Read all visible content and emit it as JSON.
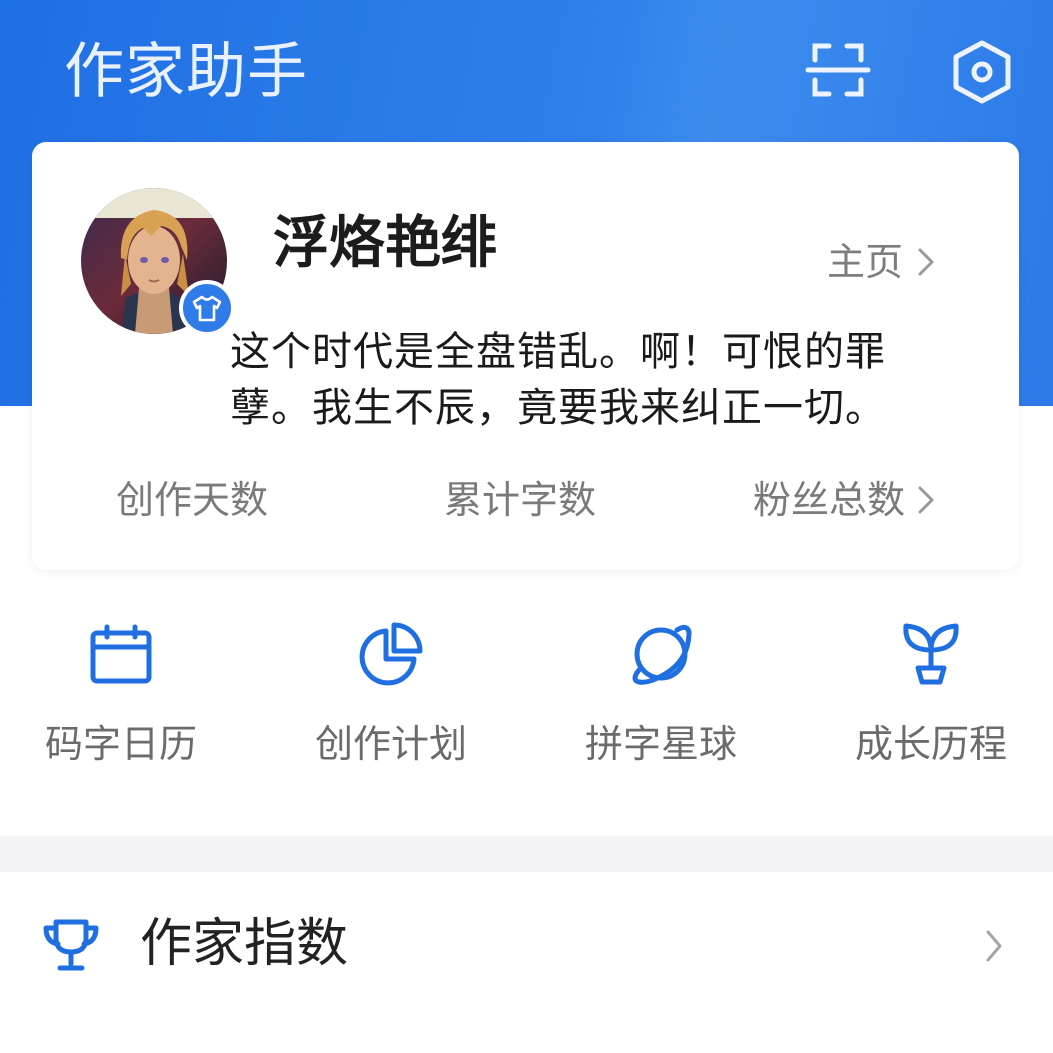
{
  "header": {
    "title": "作家助手",
    "scan_icon": "scan-icon",
    "settings_icon": "settings-hexagon-icon"
  },
  "profile": {
    "username": "浮烙艳绯",
    "homepage_label": "主页",
    "bio_line1": "这个时代是全盘错乱。啊！可恨的罪",
    "bio_line2": "孽。我生不辰，竟要我来纠正一切。",
    "badge_icon": "shirt-icon",
    "stats": [
      {
        "label": "创作天数"
      },
      {
        "label": "累计字数"
      },
      {
        "label": "粉丝总数"
      }
    ]
  },
  "shortcuts": [
    {
      "label": "码字日历",
      "icon": "calendar-icon"
    },
    {
      "label": "创作计划",
      "icon": "pie-chart-icon"
    },
    {
      "label": "拼字星球",
      "icon": "planet-icon"
    },
    {
      "label": "成长历程",
      "icon": "sprout-icon"
    }
  ],
  "menu": {
    "writer_index_label": "作家指数",
    "writer_index_icon": "trophy-icon"
  },
  "colors": {
    "brand_blue": "#2a78e6",
    "icon_blue": "#1f6fe0"
  }
}
